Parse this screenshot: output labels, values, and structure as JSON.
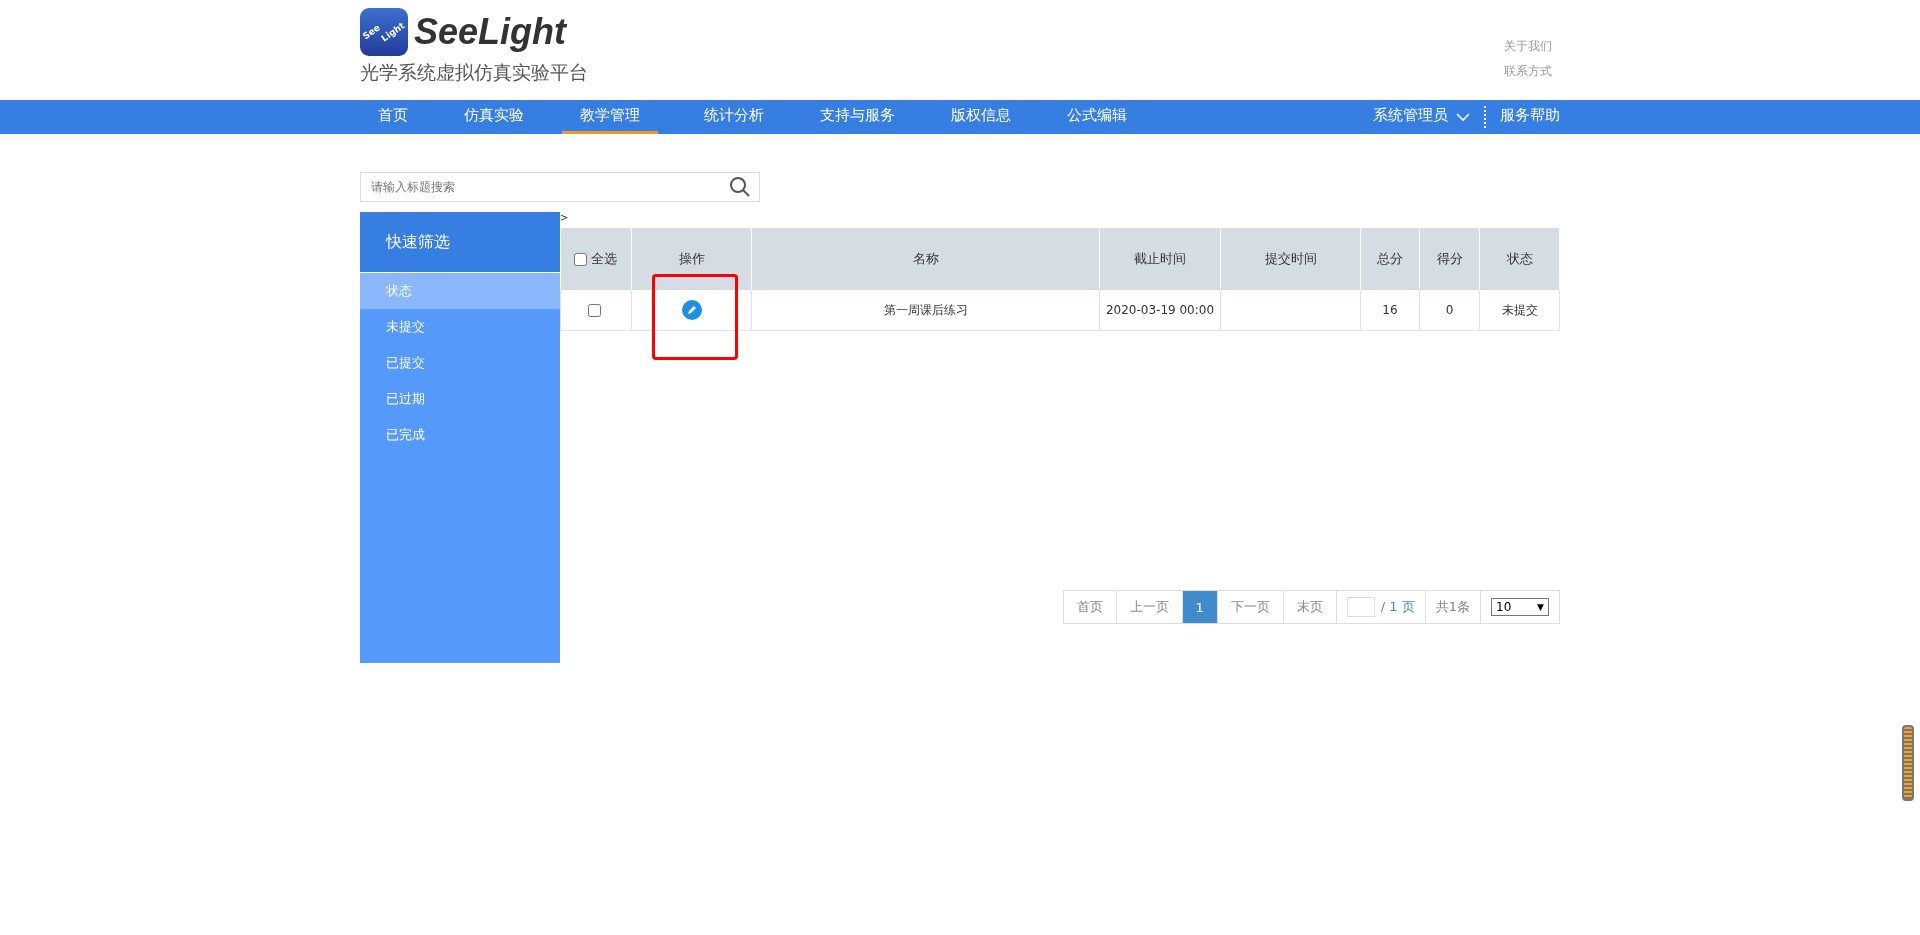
{
  "header": {
    "logo_text": "SeeLight",
    "logo_badge": [
      "See",
      "Light"
    ],
    "subtitle": "光学系统虚拟仿真实验平台",
    "links": [
      "关于我们",
      "联系方式"
    ]
  },
  "nav": {
    "items": [
      {
        "label": "首页",
        "selected": false
      },
      {
        "label": "仿真实验",
        "selected": false
      },
      {
        "label": "教学管理",
        "selected": true
      },
      {
        "label": "统计分析",
        "selected": false
      },
      {
        "label": "支持与服务",
        "selected": false
      },
      {
        "label": "版权信息",
        "selected": false
      },
      {
        "label": "公式编辑",
        "selected": false
      }
    ],
    "user": "系统管理员",
    "help": "服务帮助"
  },
  "search": {
    "placeholder": "请输入标题搜索"
  },
  "sidebar": {
    "title": "快速筛选",
    "items": [
      {
        "label": "状态",
        "selected": true
      },
      {
        "label": "未提交",
        "selected": false
      },
      {
        "label": "已提交",
        "selected": false
      },
      {
        "label": "已过期",
        "selected": false
      },
      {
        "label": "已完成",
        "selected": false
      }
    ]
  },
  "breadcrumb": ">",
  "table": {
    "select_all": {
      "label": "全选",
      "checked": false
    },
    "columns": [
      "操作",
      "名称",
      "截止时间",
      "提交时间",
      "总分",
      "得分",
      "状态"
    ],
    "rows": [
      {
        "checked": false,
        "highlighted": true,
        "name": "第一周课后练习",
        "deadline": "2020-03-19 00:00",
        "total": "16",
        "score": "0",
        "status": "未提交"
      }
    ]
  },
  "pagination": {
    "first": "首页",
    "prev": "上一页",
    "pages": [
      {
        "label": "1",
        "selected": true
      }
    ],
    "next": "下一页",
    "last": "末页",
    "page_total": "/ 1 页",
    "count": "共1条",
    "page_size": "10",
    "dropdown_arrow": "▼"
  }
}
